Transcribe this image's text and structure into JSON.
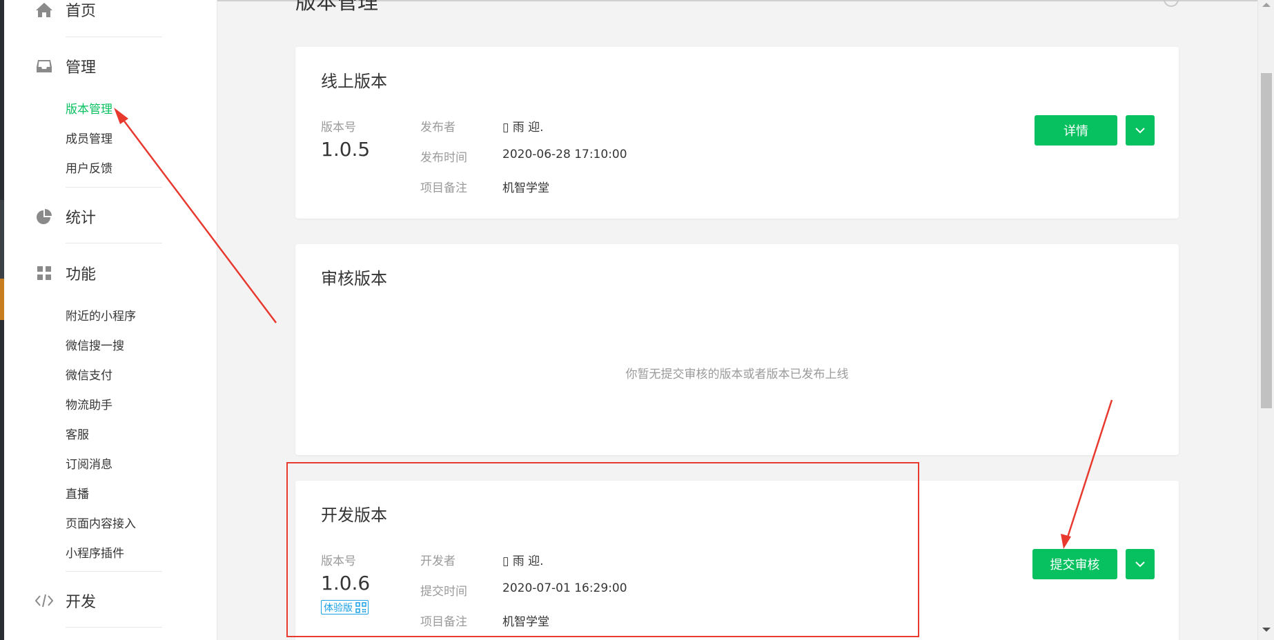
{
  "sidebar": {
    "home": {
      "label": "首页",
      "icon": "home-icon"
    },
    "manage": {
      "label": "管理",
      "icon": "inbox-icon",
      "items": [
        "版本管理",
        "成员管理",
        "用户反馈"
      ],
      "active_index": 0
    },
    "stats": {
      "label": "统计",
      "icon": "pie-chart-icon"
    },
    "features": {
      "label": "功能",
      "icon": "grid-icon",
      "items": [
        "附近的小程序",
        "微信搜一搜",
        "微信支付",
        "物流助手",
        "客服",
        "订阅消息",
        "直播",
        "页面内容接入",
        "小程序插件"
      ]
    },
    "develop": {
      "label": "开发",
      "icon": "code-icon"
    }
  },
  "page": {
    "title": "版本管理"
  },
  "online": {
    "title": "线上版本",
    "version_label": "版本号",
    "version": "1.0.5",
    "publisher_label": "发布者",
    "publisher": "▯ 雨 迎.",
    "time_label": "发布时间",
    "time": "2020-06-28 17:10:00",
    "note_label": "项目备注",
    "note": "机智学堂",
    "detail_button": "详情"
  },
  "review": {
    "title": "审核版本",
    "empty_text": "你暂无提交审核的版本或者版本已发布上线"
  },
  "dev": {
    "title": "开发版本",
    "version_label": "版本号",
    "version": "1.0.6",
    "badge": "体验版",
    "developer_label": "开发者",
    "developer": "▯ 雨 迎.",
    "time_label": "提交时间",
    "time": "2020-07-01 16:29:00",
    "note_label": "项目备注",
    "note": "机智学堂",
    "submit_button": "提交审核"
  },
  "colors": {
    "accent": "#07c160",
    "annotation": "#e8392f",
    "badge": "#1aa1e6"
  }
}
